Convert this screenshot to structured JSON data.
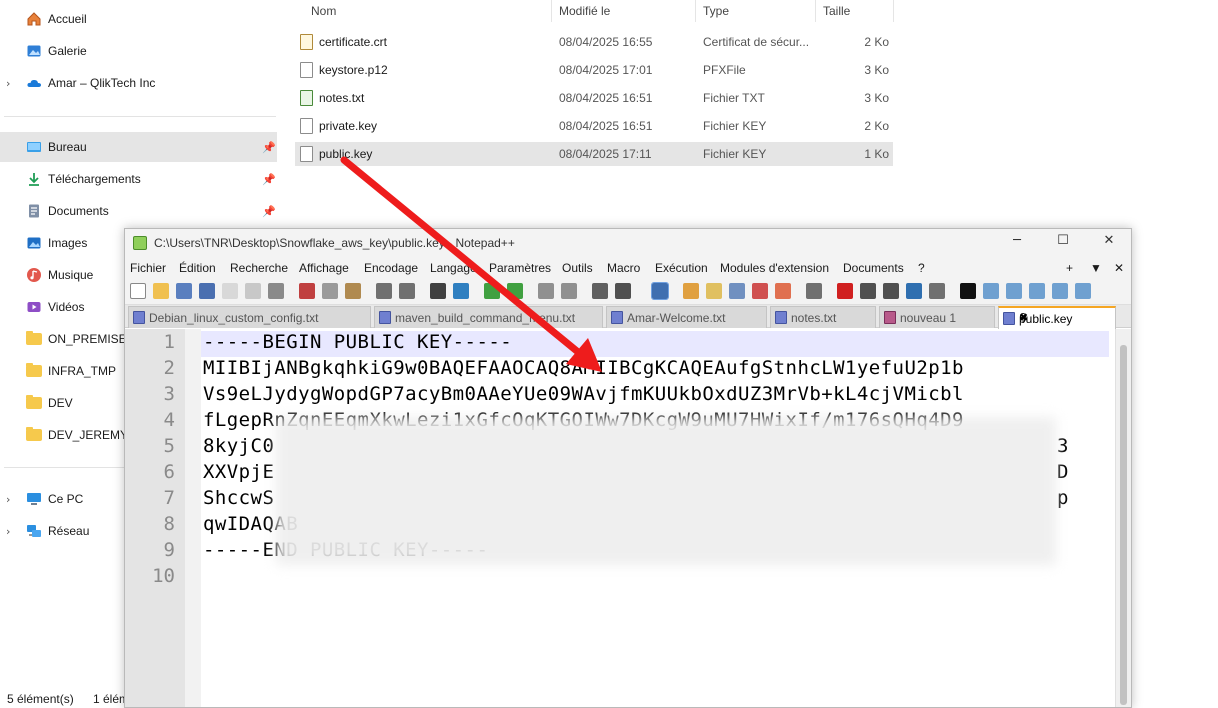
{
  "sidebar": {
    "items": [
      {
        "label": "Accueil",
        "icon": "home-icon"
      },
      {
        "label": "Galerie",
        "icon": "gallery-icon"
      },
      {
        "label": "Amar – QlikTech Inc",
        "icon": "onedrive-cloud-icon"
      },
      {
        "label": "Bureau",
        "icon": "desktop-icon"
      },
      {
        "label": "Téléchargements",
        "icon": "download-icon"
      },
      {
        "label": "Documents",
        "icon": "documents-icon"
      },
      {
        "label": "Images",
        "icon": "images-icon"
      },
      {
        "label": "Musique",
        "icon": "music-icon"
      },
      {
        "label": "Vidéos",
        "icon": "videos-icon"
      },
      {
        "label": "ON_PREMISE_",
        "icon": "folder-icon"
      },
      {
        "label": "INFRA_TMP",
        "icon": "folder-icon"
      },
      {
        "label": "DEV",
        "icon": "folder-icon"
      },
      {
        "label": "DEV_JEREMY",
        "icon": "folder-icon"
      },
      {
        "label": "Ce PC",
        "icon": "pc-icon"
      },
      {
        "label": "Réseau",
        "icon": "network-icon"
      }
    ]
  },
  "status": {
    "count": "5 élément(s)",
    "selected": "1 élém"
  },
  "filelist": {
    "headers": {
      "name": "Nom",
      "date": "Modifié le",
      "type": "Type",
      "size": "Taille"
    },
    "files": [
      {
        "name": "certificate.crt",
        "date": "08/04/2025 16:55",
        "type": "Certificat de sécur...",
        "size": "2 Ko"
      },
      {
        "name": "keystore.p12",
        "date": "08/04/2025 17:01",
        "type": "PFXFile",
        "size": "3 Ko"
      },
      {
        "name": "notes.txt",
        "date": "08/04/2025 16:51",
        "type": "Fichier TXT",
        "size": "3 Ko"
      },
      {
        "name": "private.key",
        "date": "08/04/2025 16:51",
        "type": "Fichier KEY",
        "size": "2 Ko"
      },
      {
        "name": "public.key",
        "date": "08/04/2025 17:11",
        "type": "Fichier KEY",
        "size": "1 Ko"
      }
    ]
  },
  "notepad": {
    "title": "C:\\Users\\TNR\\Desktop\\Snowflake_aws_key\\public.key - Notepad++",
    "window_controls": {
      "minimize": "─",
      "maximize": "☐",
      "close": "✕"
    },
    "menu": [
      "Fichier",
      "Édition",
      "Recherche",
      "Affichage",
      "Encodage",
      "Langage",
      "Paramètres",
      "Outils",
      "Macro",
      "Exécution",
      "Modules d'extension",
      "Documents",
      "?"
    ],
    "menu_right": {
      "plus": "+",
      "down": "▼",
      "close": "✕"
    },
    "tabs": [
      {
        "label": "Debian_linux_custom_config.txt"
      },
      {
        "label": "maven_build_command_menu.txt"
      },
      {
        "label": "Amar-Welcome.txt"
      },
      {
        "label": "notes.txt"
      },
      {
        "label": "nouveau 1"
      },
      {
        "label": "public.key"
      }
    ],
    "line_numbers": [
      "1",
      "2",
      "3",
      "4",
      "5",
      "6",
      "7",
      "8",
      "9",
      "10"
    ],
    "lines": [
      "-----BEGIN PUBLIC KEY-----",
      "MIIBIjANBgkqhkiG9w0BAQEFAAOCAQ8AMIIBCgKCAQEAufgStnhcLW1yefuU2p1b",
      "Vs9eLJydygWopdGP7acyBm0AAeYUe09WAvjfmKUUkbOxdUZ3MrVb+kL4cjVMicbl",
      "fLgepRnZqnEEqmXkwLezi1xGfcOqKTGOIWw7DKcgW9uMU7HWixIf/m176sQHq4D9",
      "8kyjC0",
      "XXVpjE",
      "ShccwS",
      "qwIDAQAB",
      "-----END PUBLIC KEY-----",
      ""
    ],
    "tail_chars": {
      "line5": "3",
      "line6": "D",
      "line7": "p"
    }
  }
}
